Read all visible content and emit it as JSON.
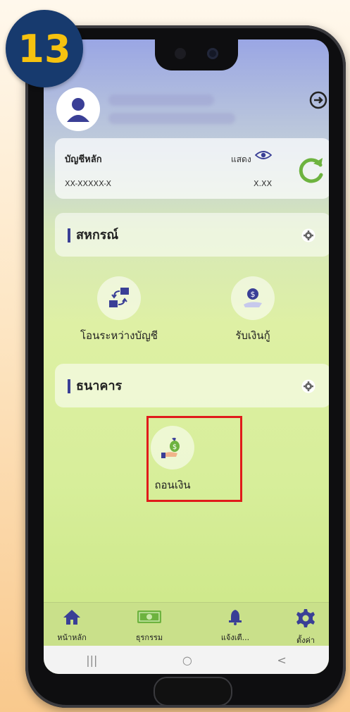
{
  "step_badge": "13",
  "header": {
    "account_label": "บัญชีหลัก",
    "show_label": "แสดง",
    "account_number": "XX-XXXXX-X",
    "balance": "X.XX"
  },
  "sections": {
    "cooperative": {
      "title": "สหกรณ์",
      "actions": [
        {
          "label": "โอนระหว่างบัญชี",
          "icon": "transfer-icon"
        },
        {
          "label": "รับเงินกู้",
          "icon": "receive-loan-icon"
        }
      ]
    },
    "bank": {
      "title": "ธนาคาร",
      "actions": [
        {
          "label": "ถอนเงิน",
          "icon": "withdraw-icon"
        }
      ]
    }
  },
  "bottom_nav": [
    {
      "label": "หน้าหลัก",
      "icon": "home-icon"
    },
    {
      "label": "ธุรกรรม",
      "icon": "money-icon"
    },
    {
      "label": "แจ้งเตื...",
      "icon": "bell-icon"
    },
    {
      "label": "ตั้งค่า",
      "icon": "gear-icon"
    }
  ],
  "system_nav": {
    "recent": "|||",
    "home": "○",
    "back": "<"
  },
  "colors": {
    "accent": "#3a3f96",
    "refresh": "#6db33f",
    "highlight": "#e01b1b",
    "badge_bg": "#173a6e",
    "badge_text": "#f6c20f"
  }
}
